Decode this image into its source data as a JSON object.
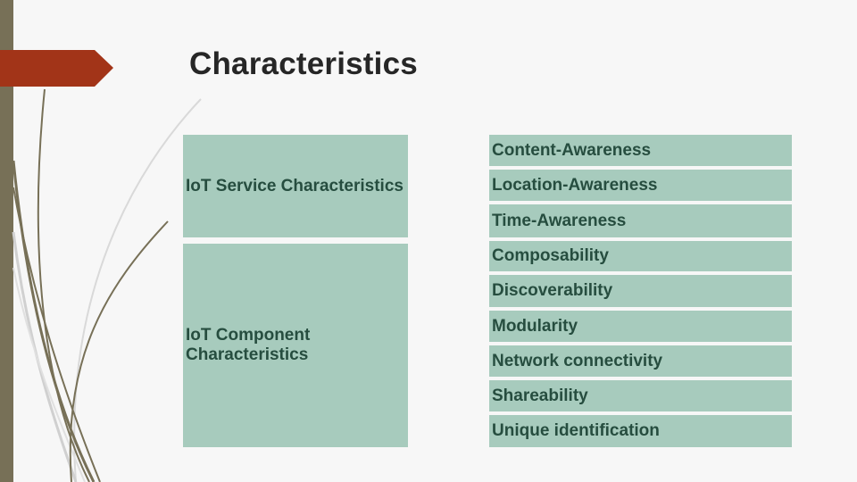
{
  "slide": {
    "title": "Characteristics",
    "colors": {
      "accent_arrow": "#a23418",
      "sidebar": "#777057",
      "cell_fill": "#a7cbbd",
      "cell_text": "#264d3f",
      "title_text": "#262626"
    }
  },
  "table": {
    "groups": [
      {
        "label": "IoT Service Characteristics",
        "items": [
          "Content-Awareness",
          "Location-Awareness",
          "Time-Awareness"
        ]
      },
      {
        "label": "IoT Component Characteristics",
        "items": [
          "Composability",
          "Discoverability",
          "Modularity",
          "Network connectivity",
          "Shareability",
          "Unique identification"
        ]
      }
    ]
  }
}
